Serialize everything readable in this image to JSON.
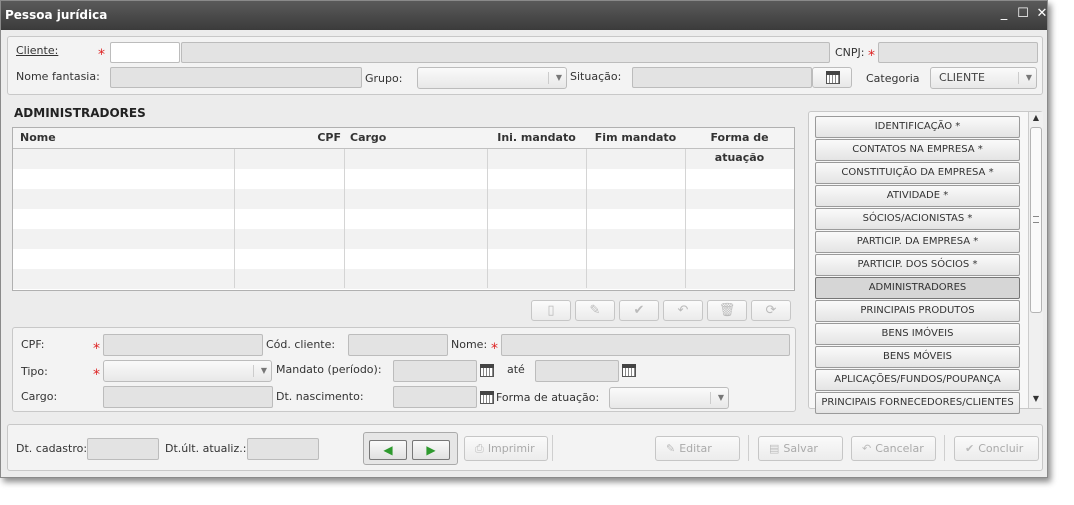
{
  "window": {
    "title": "Pessoa jurídica",
    "minimize": "_",
    "maximize": "☐",
    "close": "✕"
  },
  "top": {
    "cliente_label": "Cliente:",
    "cnpj_label": "CNPJ:",
    "nome_fantasia_label": "Nome fantasia:",
    "grupo_label": "Grupo:",
    "situacao_label": "Situação:",
    "categoria_label": "Categoria",
    "categoria_value": "CLIENTE"
  },
  "administradores": {
    "title": "ADMINISTRADORES",
    "columns": [
      "Nome",
      "CPF",
      "Cargo",
      "Ini. mandato",
      "Fim mandato",
      "Forma de atuação"
    ]
  },
  "detail": {
    "cpf_label": "CPF:",
    "cod_cliente_label": "Cód. cliente:",
    "nome_label": "Nome:",
    "tipo_label": "Tipo:",
    "mandato_label": "Mandato (período):",
    "ate_label": "até",
    "cargo_label": "Cargo:",
    "dt_nascimento_label": "Dt. nascimento:",
    "forma_atuacao_label": "Forma de atuação:"
  },
  "sections": [
    "IDENTIFICAÇÃO *",
    "CONTATOS NA EMPRESA *",
    "CONSTITUIÇÃO DA EMPRESA *",
    "ATIVIDADE *",
    "SÓCIOS/ACIONISTAS *",
    "PARTICIP. DA EMPRESA *",
    "PARTICIP. DOS SÓCIOS *",
    "ADMINISTRADORES",
    "PRINCIPAIS PRODUTOS",
    "BENS IMÓVEIS",
    "BENS MÓVEIS",
    "APLICAÇÕES/FUNDOS/POUPANÇA",
    "PRINCIPAIS FORNECEDORES/CLIENTES"
  ],
  "footer": {
    "dt_cadastro_label": "Dt. cadastro:",
    "dt_ult_atualiz_label": "Dt.últ. atualiz.:",
    "imprimir": "Imprimir",
    "editar": "Editar",
    "salvar": "Salvar",
    "cancelar": "Cancelar",
    "concluir": "Concluir"
  },
  "colors": {
    "titlebar": "#3f3f3f",
    "required": "#dd2222",
    "nav_arrow": "#2e9a2e"
  }
}
